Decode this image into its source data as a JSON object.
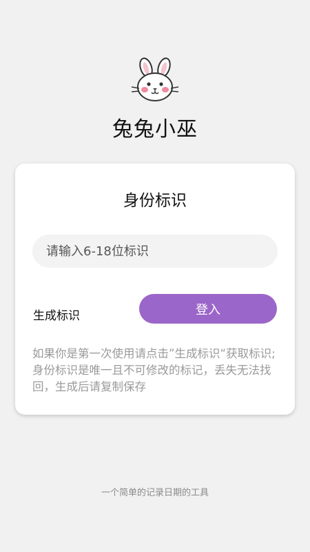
{
  "app": {
    "title": "兔兔小巫",
    "logo_icon": "rabbit-icon"
  },
  "card": {
    "title": "身份标识",
    "input": {
      "value": "",
      "placeholder": "请输入6-18位标识"
    },
    "generate_label": "生成标识",
    "login_label": "登入",
    "notice": "如果你是第一次使用请点击”生成标识“获取标识;身份标识是唯一且不可修改的标记，丢失无法找回，生成后请复制保存"
  },
  "footer": {
    "text": "一个简单的记录日期的工具"
  },
  "colors": {
    "accent": "#9b66c9",
    "background": "#f1f1f1",
    "card": "#ffffff",
    "cheek": "#f08aa0"
  }
}
